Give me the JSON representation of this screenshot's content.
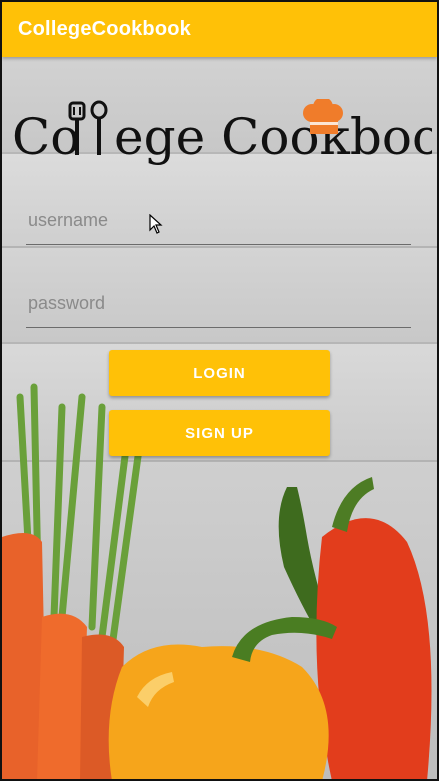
{
  "appbar": {
    "title": "CollegeCookbook"
  },
  "logo": {
    "text_part1": "Co",
    "text_part2": "ege Cookbook",
    "brand_text": "College Cookbook"
  },
  "form": {
    "username_placeholder": "username",
    "password_placeholder": "password",
    "login_label": "LOGIN",
    "signup_label": "SIGN UP"
  },
  "colors": {
    "accent": "#FFC107",
    "text_on_accent": "#FFFFFF"
  },
  "icons": [
    "chef-hat-icon",
    "spatula-icon",
    "ladle-icon",
    "mouse-cursor-icon"
  ]
}
